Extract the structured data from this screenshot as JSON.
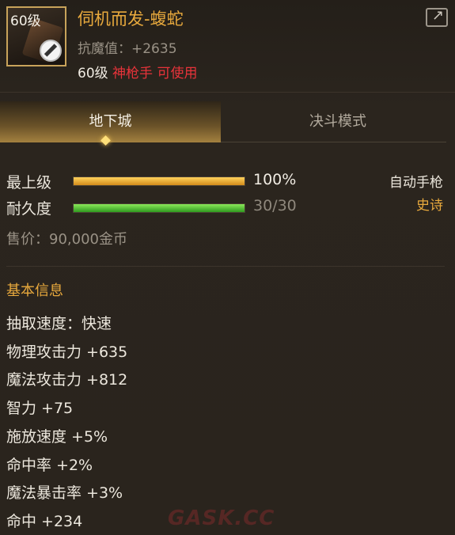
{
  "item": {
    "icon_level": "60级",
    "name": "伺机而发-蝮蛇",
    "stat": "抗魔值：+2635",
    "req_level": "60级",
    "req_class": "神枪手 可使用"
  },
  "tabs": [
    "地下城",
    "决斗模式"
  ],
  "bars": [
    {
      "label": "最上级",
      "value_text": "100%",
      "fraction": 1.0,
      "color": "#e6a22a"
    },
    {
      "label": "耐久度",
      "value_text": "30/30",
      "fraction": 1.0,
      "color": "#4cc22e"
    }
  ],
  "type": "自动手枪",
  "rarity": "史诗",
  "price": "售价：90,000金币",
  "basic_title": "基本信息",
  "attributes": [
    "抽取速度：快速",
    "物理攻击力 +635",
    "魔法攻击力 +812",
    "智力 +75",
    "施放速度 +5%",
    "命中率 +2%",
    "魔法暴击率 +3%",
    "命中 +234"
  ],
  "watermark": "GASK.CC"
}
